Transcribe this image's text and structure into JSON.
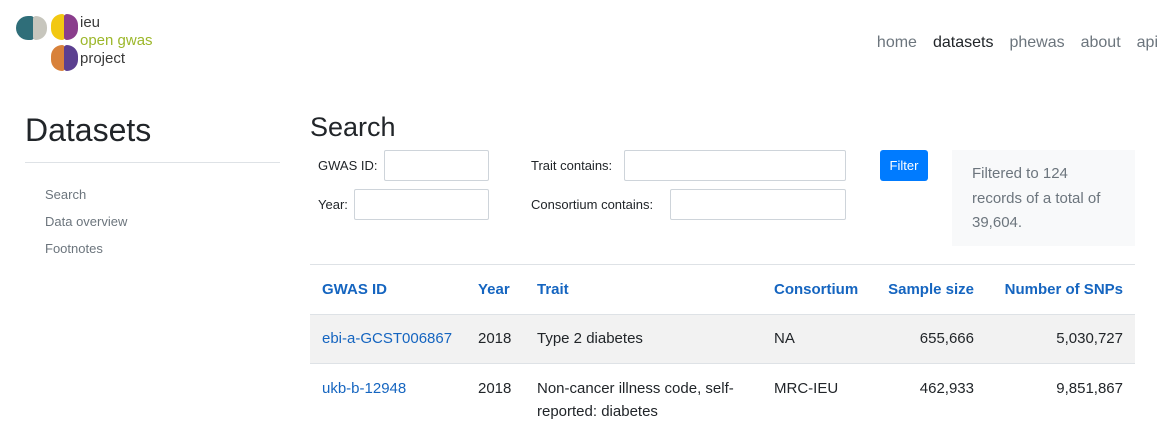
{
  "logo": {
    "line1": "ieu",
    "line2": "open gwas",
    "line3": "project",
    "colors": [
      "#2f6e79",
      "#c7c6bd",
      "#f2c811",
      "#8a3d8c",
      "#d8813a",
      "#5b3f90"
    ]
  },
  "topnav": {
    "items": [
      {
        "label": "home",
        "active": false
      },
      {
        "label": "datasets",
        "active": true
      },
      {
        "label": "phewas",
        "active": false
      },
      {
        "label": "about",
        "active": false
      },
      {
        "label": "api",
        "active": false
      }
    ]
  },
  "sidebar": {
    "title": "Datasets",
    "items": [
      {
        "label": "Search"
      },
      {
        "label": "Data overview"
      },
      {
        "label": "Footnotes"
      }
    ]
  },
  "search": {
    "title": "Search",
    "gwas_id_label": "GWAS ID:",
    "gwas_id_value": "",
    "year_label": "Year:",
    "year_value": "",
    "trait_label": "Trait contains:",
    "trait_value": "",
    "consortium_label": "Consortium contains:",
    "consortium_value": "",
    "filter_button": "Filter",
    "filter_note": "Filtered to 124 records of a total of 39,604."
  },
  "table": {
    "headers": [
      "GWAS ID",
      "Year",
      "Trait",
      "Consortium",
      "Sample size",
      "Number of SNPs"
    ],
    "rows": [
      {
        "id": "ebi-a-GCST006867",
        "year": "2018",
        "trait": "Type 2 diabetes",
        "consortium": "NA",
        "sample_size": "655,666",
        "snps": "5,030,727"
      },
      {
        "id": "ukb-b-12948",
        "year": "2018",
        "trait": "Non-cancer illness code, self-reported: diabetes",
        "consortium": "MRC-IEU",
        "sample_size": "462,933",
        "snps": "9,851,867"
      }
    ]
  },
  "colors": {
    "link": "#1565c0",
    "primary_button": "#007bff",
    "muted": "#6c757d"
  }
}
